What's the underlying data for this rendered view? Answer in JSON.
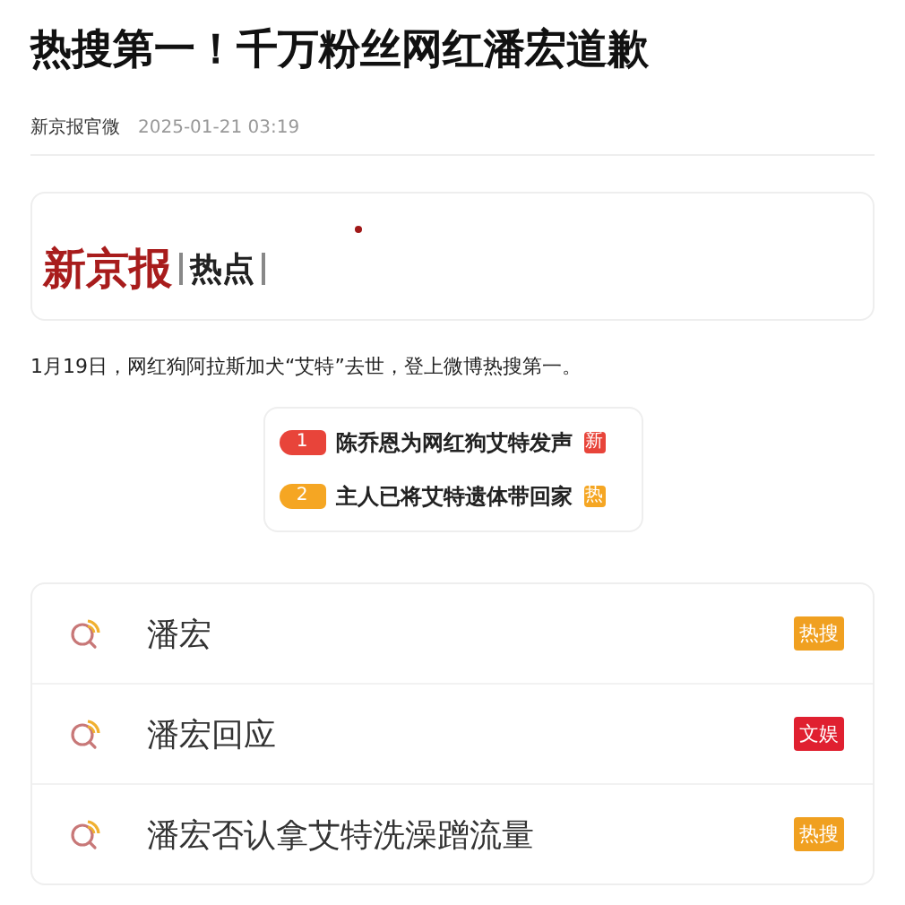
{
  "headline": "热搜第一！千万粉丝网红潘宏道歉",
  "meta": {
    "source": "新京报官微",
    "time": "2025-01-21 03:19"
  },
  "banner": {
    "brand": "新京报",
    "section": "热点"
  },
  "paragraph": "1月19日，网红狗阿拉斯加犬“艾特”去世，登上微博热搜第一。",
  "hot_list": [
    {
      "rank": "1",
      "title": "陈乔恩为网红狗艾特发声",
      "badge": "新",
      "color": "#e8443a"
    },
    {
      "rank": "2",
      "title": "主人已将艾特遗体带回家",
      "badge": "热",
      "color": "#f5a623"
    }
  ],
  "searches": [
    {
      "query": "潘宏",
      "tag": "热搜",
      "color": "#f0a020"
    },
    {
      "query": "潘宏回应",
      "tag": "文娱",
      "color": "#e02030"
    },
    {
      "query": "潘宏否认拿艾特洗澡蹭流量",
      "tag": "热搜",
      "color": "#f0a020"
    }
  ]
}
